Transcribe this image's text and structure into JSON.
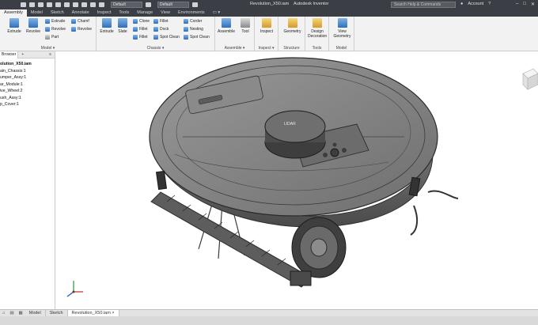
{
  "titlebar": {
    "dropdown_1": "Default",
    "dropdown_2": "Default",
    "title": "Revolution_X50.iam",
    "product": "Autodesk Inventor",
    "search_placeholder": "Search Help & Commands",
    "user": "Account"
  },
  "tabs": [
    "Assembly",
    "Model",
    "Sketch",
    "Annotate",
    "Inspect",
    "Tools",
    "Manage",
    "View",
    "Environments"
  ],
  "ribbon": {
    "panels": {
      "model": "Model",
      "chassis": "Chassis",
      "assemble": "Assemble",
      "inspect": "Inspect",
      "structure": "Structure",
      "tools": "Tools",
      "model2": "Model"
    },
    "buttons": {
      "extrude": "Extrude",
      "revolve": "Revolve",
      "s_extrude": "Extrude",
      "s_revolve": "Revolve",
      "s_part": "Part",
      "s_chamfer": "Chamf",
      "s_revolve2": "Revolve",
      "extrude2": "Extrude",
      "slate": "Slate",
      "clone": "Clone",
      "fillet": "Fillet",
      "fillet2": "Fillet",
      "fillet3": "Fillet",
      "dock": "Dock",
      "spot_clean": "Spot Clean",
      "corner": "Corder",
      "nesting": "Nesting",
      "spot_clean2": "Spot Clean",
      "assemble": "Assemble",
      "tool": "Tool",
      "inspect": "Inspect",
      "geometry": "Geometry",
      "design_doc": "Design Decoration",
      "view_geom": "View Geometry"
    }
  },
  "browser": {
    "tab": "Browser",
    "items": [
      "olution_X50.iam",
      "ain_Chassis:1",
      "umper_Assy:1",
      "ar_Module:1",
      "ive_Wheel:2",
      "ush_Assy:1",
      "p_Cover:1"
    ]
  },
  "doc_tabs": [
    "Model",
    "Sketch",
    "Revolution_X50.iam"
  ],
  "model_label": "LIDAR"
}
